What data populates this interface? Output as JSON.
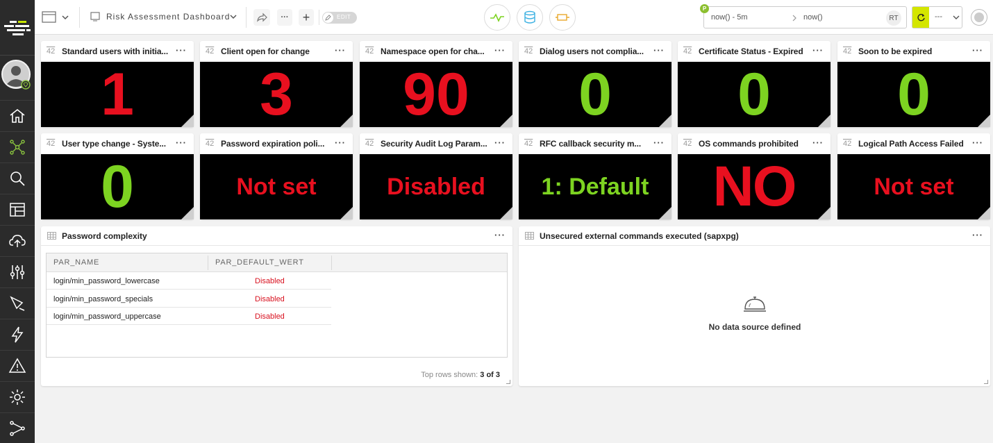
{
  "toolbar": {
    "dashboard_title": "Risk Assessment Dashboard",
    "edit_label": "EDIT",
    "more_label": "···",
    "add_label": "+"
  },
  "timeframe": {
    "badge": "P",
    "from": "now() - 5m",
    "to": "now()",
    "mode": "RT",
    "refresh_interval": "---"
  },
  "colors": {
    "red": "#e8101f",
    "green": "#7dd321",
    "accent": "#d4e600"
  },
  "tiles": [
    {
      "title": "Standard users with initia...",
      "value": "1",
      "color": "red"
    },
    {
      "title": "Client open for change",
      "value": "3",
      "color": "red"
    },
    {
      "title": "Namespace open for cha...",
      "value": "90",
      "color": "red"
    },
    {
      "title": "Dialog users not complia...",
      "value": "0",
      "color": "green"
    },
    {
      "title": "Certificate Status - Expired",
      "value": "0",
      "color": "green"
    },
    {
      "title": "Soon to be expired",
      "value": "0",
      "color": "green"
    },
    {
      "title": "User type change - Syste...",
      "value": "0",
      "color": "green"
    },
    {
      "title": "Password expiration poli...",
      "value": "Not set",
      "color": "red"
    },
    {
      "title": "Security Audit Log Param...",
      "value": "Disabled",
      "color": "red"
    },
    {
      "title": "RFC callback security m...",
      "value": "1: Default",
      "color": "green"
    },
    {
      "title": "OS commands prohibited",
      "value": "NO",
      "color": "red"
    },
    {
      "title": "Logical Path Access Failed",
      "value": "Not set",
      "color": "red"
    }
  ],
  "tile_icon_label": "42",
  "tile_menu_label": "···",
  "password_panel": {
    "title": "Password complexity",
    "columns": [
      "PAR_NAME",
      "PAR_DEFAULT_WERT"
    ],
    "rows": [
      {
        "name": "login/min_password_lowercase",
        "value": "Disabled"
      },
      {
        "name": "login/min_password_specials",
        "value": "Disabled"
      },
      {
        "name": "login/min_password_uppercase",
        "value": "Disabled"
      }
    ],
    "footer_label": "Top rows shown:",
    "footer_value": "3 of 3"
  },
  "commands_panel": {
    "title": "Unsecured external commands executed (sapxpg)",
    "empty_text": "No data source defined"
  },
  "sidebar": {
    "items": [
      "home-icon",
      "network-icon",
      "search-icon",
      "dashboard-icon",
      "cloud-upload-icon",
      "sliders-icon",
      "transform-icon",
      "lightning-icon",
      "warning-icon",
      "gear-icon",
      "flow-icon"
    ]
  }
}
